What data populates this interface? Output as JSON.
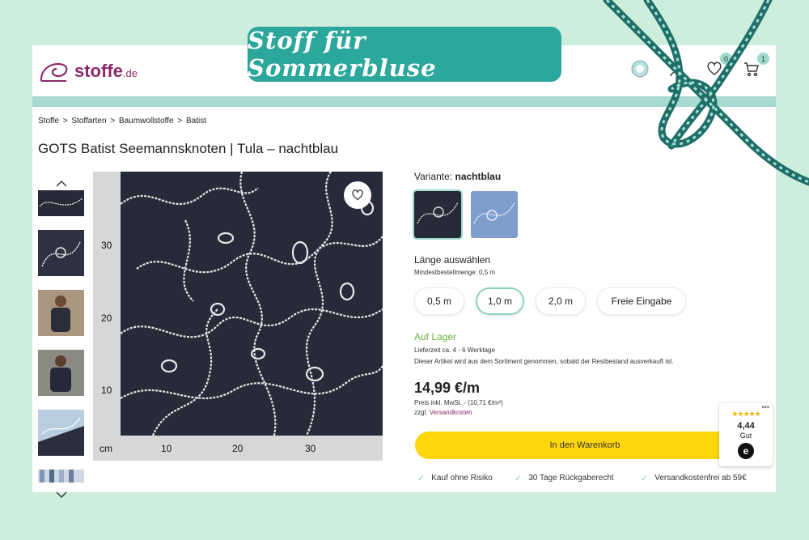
{
  "banner": {
    "title": "Stoff für Sommerbluse"
  },
  "header": {
    "logo_text": "stoffe",
    "logo_tld": ".de",
    "wishlist_count": "0",
    "cart_count": "1"
  },
  "breadcrumb": {
    "items": [
      "Stoffe",
      "Stoffarten",
      "Baumwollstoffe",
      "Batist"
    ],
    "separator": ">"
  },
  "product": {
    "title": "GOTS Batist Seemannsknoten | Tula – nachtblau",
    "image_scale": {
      "y_labels": [
        "30",
        "20",
        "10"
      ],
      "x_labels": [
        "10",
        "20",
        "30"
      ],
      "unit": "cm"
    }
  },
  "variant": {
    "label": "Variante:",
    "value": "nachtblau"
  },
  "length": {
    "title": "Länge auswählen",
    "min_order": "Mindestbestellmenge: 0,5 m",
    "options": [
      "0,5 m",
      "1,0 m",
      "2,0 m",
      "Freie Eingabe"
    ],
    "selected": "1,0 m"
  },
  "availability": {
    "status": "Auf Lager",
    "delivery": "Lieferzeit ca. 4 - 6 Werktage",
    "note": "Dieser Artikel wird aus dem Sortiment genommen, sobald der Restbestand ausverkauft ist."
  },
  "price": {
    "value": "14,99 €/m",
    "tax_note": "Preis inkl. MwSt. - (10,71 €/m²)",
    "shipping_prefix": "zzgl.",
    "shipping_link": "Versandkosten"
  },
  "cart": {
    "button_label": "In den Warenkorb"
  },
  "usps": [
    "Kauf ohne Risiko",
    "30 Tage Rückgaberecht",
    "Versandkostenfrei ab 59€"
  ],
  "trust_badge": {
    "stars": "★★★★★",
    "score": "4,44",
    "label": "Gut",
    "logo": "e"
  },
  "colors": {
    "brand": "#8a2b6a",
    "teal": "#2ba79b",
    "accent": "#9fd9cc",
    "cart_yellow": "#ffd60a",
    "stock_green": "#6db33f",
    "fabric_navy": "#272a38"
  },
  "icons": [
    "account-badge-icon",
    "user-icon",
    "heart-icon",
    "cart-icon",
    "chevron-up-icon",
    "chevron-down-icon",
    "checkmark-icon"
  ]
}
